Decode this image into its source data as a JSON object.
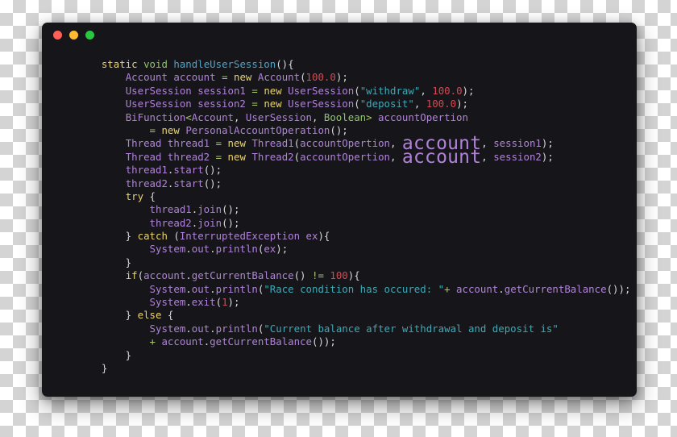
{
  "window": {
    "title": "",
    "traffic_lights": [
      {
        "name": "close",
        "color": "#ff5f57"
      },
      {
        "name": "minimize",
        "color": "#febc2e"
      },
      {
        "name": "zoom",
        "color": "#28c840"
      }
    ],
    "background_color": "#16161a"
  },
  "editor": {
    "language": "java",
    "emphasized_token": "account",
    "lines": [
      [
        {
          "t": "    ",
          "c": "pn"
        },
        {
          "t": "static",
          "c": "kw"
        },
        {
          "t": " ",
          "c": "pn"
        },
        {
          "t": "void",
          "c": "type2"
        },
        {
          "t": " ",
          "c": "pn"
        },
        {
          "t": "handleUserSession",
          "c": "fn"
        },
        {
          "t": "(){",
          "c": "pn"
        }
      ],
      [
        {
          "t": "        ",
          "c": "pn"
        },
        {
          "t": "Account",
          "c": "cls"
        },
        {
          "t": " ",
          "c": "pn"
        },
        {
          "t": "account",
          "c": "id"
        },
        {
          "t": " ",
          "c": "pn"
        },
        {
          "t": "=",
          "c": "op"
        },
        {
          "t": " ",
          "c": "pn"
        },
        {
          "t": "new",
          "c": "kw"
        },
        {
          "t": " ",
          "c": "pn"
        },
        {
          "t": "Account",
          "c": "cls"
        },
        {
          "t": "(",
          "c": "pn"
        },
        {
          "t": "100.0",
          "c": "num"
        },
        {
          "t": ");",
          "c": "pn"
        }
      ],
      [
        {
          "t": "        ",
          "c": "pn"
        },
        {
          "t": "UserSession",
          "c": "cls"
        },
        {
          "t": " ",
          "c": "pn"
        },
        {
          "t": "session1",
          "c": "id"
        },
        {
          "t": " ",
          "c": "pn"
        },
        {
          "t": "=",
          "c": "op"
        },
        {
          "t": " ",
          "c": "pn"
        },
        {
          "t": "new",
          "c": "kw"
        },
        {
          "t": " ",
          "c": "pn"
        },
        {
          "t": "UserSession",
          "c": "cls"
        },
        {
          "t": "(",
          "c": "pn"
        },
        {
          "t": "\"withdraw\"",
          "c": "str"
        },
        {
          "t": ", ",
          "c": "pn"
        },
        {
          "t": "100.0",
          "c": "num"
        },
        {
          "t": ");",
          "c": "pn"
        }
      ],
      [
        {
          "t": "        ",
          "c": "pn"
        },
        {
          "t": "UserSession",
          "c": "cls"
        },
        {
          "t": " ",
          "c": "pn"
        },
        {
          "t": "session2",
          "c": "id"
        },
        {
          "t": " ",
          "c": "pn"
        },
        {
          "t": "=",
          "c": "op"
        },
        {
          "t": " ",
          "c": "pn"
        },
        {
          "t": "new",
          "c": "kw"
        },
        {
          "t": " ",
          "c": "pn"
        },
        {
          "t": "UserSession",
          "c": "cls"
        },
        {
          "t": "(",
          "c": "pn"
        },
        {
          "t": "\"deposit\"",
          "c": "str"
        },
        {
          "t": ", ",
          "c": "pn"
        },
        {
          "t": "100.0",
          "c": "num"
        },
        {
          "t": ");",
          "c": "pn"
        }
      ],
      [
        {
          "t": "        ",
          "c": "pn"
        },
        {
          "t": "BiFunction",
          "c": "cls"
        },
        {
          "t": "<",
          "c": "op"
        },
        {
          "t": "Account",
          "c": "cls"
        },
        {
          "t": ", ",
          "c": "pn"
        },
        {
          "t": "UserSession",
          "c": "cls"
        },
        {
          "t": ", ",
          "c": "pn"
        },
        {
          "t": "Boolean",
          "c": "type2"
        },
        {
          "t": ">",
          "c": "op"
        },
        {
          "t": " ",
          "c": "pn"
        },
        {
          "t": "accountOpertion",
          "c": "id"
        }
      ],
      [
        {
          "t": "            ",
          "c": "pn"
        },
        {
          "t": "=",
          "c": "op"
        },
        {
          "t": " ",
          "c": "pn"
        },
        {
          "t": "new",
          "c": "kw"
        },
        {
          "t": " ",
          "c": "pn"
        },
        {
          "t": "PersonalAccountOperation",
          "c": "cls"
        },
        {
          "t": "();",
          "c": "pn"
        }
      ],
      [
        {
          "t": "        ",
          "c": "pn"
        },
        {
          "t": "Thread",
          "c": "cls"
        },
        {
          "t": " ",
          "c": "pn"
        },
        {
          "t": "thread1",
          "c": "id"
        },
        {
          "t": " ",
          "c": "pn"
        },
        {
          "t": "=",
          "c": "op"
        },
        {
          "t": " ",
          "c": "pn"
        },
        {
          "t": "new",
          "c": "kw"
        },
        {
          "t": " ",
          "c": "pn"
        },
        {
          "t": "Thread1",
          "c": "cls"
        },
        {
          "t": "(",
          "c": "pn"
        },
        {
          "t": "accountOpertion",
          "c": "id"
        },
        {
          "t": ", ",
          "c": "pn"
        },
        {
          "t": "account",
          "c": "id",
          "big": true
        },
        {
          "t": ", ",
          "c": "pn"
        },
        {
          "t": "session1",
          "c": "id"
        },
        {
          "t": ");",
          "c": "pn"
        }
      ],
      [
        {
          "t": "        ",
          "c": "pn"
        },
        {
          "t": "Thread",
          "c": "cls"
        },
        {
          "t": " ",
          "c": "pn"
        },
        {
          "t": "thread2",
          "c": "id"
        },
        {
          "t": " ",
          "c": "pn"
        },
        {
          "t": "=",
          "c": "op"
        },
        {
          "t": " ",
          "c": "pn"
        },
        {
          "t": "new",
          "c": "kw"
        },
        {
          "t": " ",
          "c": "pn"
        },
        {
          "t": "Thread2",
          "c": "cls"
        },
        {
          "t": "(",
          "c": "pn"
        },
        {
          "t": "accountOpertion",
          "c": "id"
        },
        {
          "t": ", ",
          "c": "pn"
        },
        {
          "t": "account",
          "c": "id",
          "big": true
        },
        {
          "t": ", ",
          "c": "pn"
        },
        {
          "t": "session2",
          "c": "id"
        },
        {
          "t": ");",
          "c": "pn"
        }
      ],
      [
        {
          "t": "        ",
          "c": "pn"
        },
        {
          "t": "thread1",
          "c": "id"
        },
        {
          "t": ".",
          "c": "pn"
        },
        {
          "t": "start",
          "c": "id"
        },
        {
          "t": "();",
          "c": "pn"
        }
      ],
      [
        {
          "t": "        ",
          "c": "pn"
        },
        {
          "t": "thread2",
          "c": "id"
        },
        {
          "t": ".",
          "c": "pn"
        },
        {
          "t": "start",
          "c": "id"
        },
        {
          "t": "();",
          "c": "pn"
        }
      ],
      [
        {
          "t": "        ",
          "c": "pn"
        },
        {
          "t": "try",
          "c": "kw"
        },
        {
          "t": " {",
          "c": "pn"
        }
      ],
      [
        {
          "t": "            ",
          "c": "pn"
        },
        {
          "t": "thread1",
          "c": "id"
        },
        {
          "t": ".",
          "c": "pn"
        },
        {
          "t": "join",
          "c": "id"
        },
        {
          "t": "();",
          "c": "pn"
        }
      ],
      [
        {
          "t": "            ",
          "c": "pn"
        },
        {
          "t": "thread2",
          "c": "id"
        },
        {
          "t": ".",
          "c": "pn"
        },
        {
          "t": "join",
          "c": "id"
        },
        {
          "t": "();",
          "c": "pn"
        }
      ],
      [
        {
          "t": "        } ",
          "c": "pn"
        },
        {
          "t": "catch",
          "c": "kw"
        },
        {
          "t": " (",
          "c": "pn"
        },
        {
          "t": "InterruptedException",
          "c": "cls"
        },
        {
          "t": " ",
          "c": "pn"
        },
        {
          "t": "ex",
          "c": "id"
        },
        {
          "t": "){",
          "c": "pn"
        }
      ],
      [
        {
          "t": "            ",
          "c": "pn"
        },
        {
          "t": "System",
          "c": "id"
        },
        {
          "t": ".",
          "c": "pn"
        },
        {
          "t": "out",
          "c": "id"
        },
        {
          "t": ".",
          "c": "pn"
        },
        {
          "t": "println",
          "c": "id"
        },
        {
          "t": "(",
          "c": "pn"
        },
        {
          "t": "ex",
          "c": "id"
        },
        {
          "t": ");",
          "c": "pn"
        }
      ],
      [
        {
          "t": "        }",
          "c": "pn"
        }
      ],
      [
        {
          "t": "        ",
          "c": "pn"
        },
        {
          "t": "if",
          "c": "kw"
        },
        {
          "t": "(",
          "c": "pn"
        },
        {
          "t": "account",
          "c": "id"
        },
        {
          "t": ".",
          "c": "pn"
        },
        {
          "t": "getCurrentBalance",
          "c": "id"
        },
        {
          "t": "() ",
          "c": "pn"
        },
        {
          "t": "!=",
          "c": "op"
        },
        {
          "t": " ",
          "c": "pn"
        },
        {
          "t": "100",
          "c": "num"
        },
        {
          "t": "){",
          "c": "pn"
        }
      ],
      [
        {
          "t": "            ",
          "c": "pn"
        },
        {
          "t": "System",
          "c": "id"
        },
        {
          "t": ".",
          "c": "pn"
        },
        {
          "t": "out",
          "c": "id"
        },
        {
          "t": ".",
          "c": "pn"
        },
        {
          "t": "println",
          "c": "id"
        },
        {
          "t": "(",
          "c": "pn"
        },
        {
          "t": "\"Race condition has occured: \"",
          "c": "str"
        },
        {
          "t": "+",
          "c": "op"
        },
        {
          "t": " ",
          "c": "pn"
        },
        {
          "t": "account",
          "c": "id"
        },
        {
          "t": ".",
          "c": "pn"
        },
        {
          "t": "getCurrentBalance",
          "c": "id"
        },
        {
          "t": "());",
          "c": "pn"
        }
      ],
      [
        {
          "t": "            ",
          "c": "pn"
        },
        {
          "t": "System",
          "c": "id"
        },
        {
          "t": ".",
          "c": "pn"
        },
        {
          "t": "exit",
          "c": "id"
        },
        {
          "t": "(",
          "c": "pn"
        },
        {
          "t": "1",
          "c": "num"
        },
        {
          "t": ");",
          "c": "pn"
        }
      ],
      [
        {
          "t": "        } ",
          "c": "pn"
        },
        {
          "t": "else",
          "c": "kw"
        },
        {
          "t": " {",
          "c": "pn"
        }
      ],
      [
        {
          "t": "            ",
          "c": "pn"
        },
        {
          "t": "System",
          "c": "id"
        },
        {
          "t": ".",
          "c": "pn"
        },
        {
          "t": "out",
          "c": "id"
        },
        {
          "t": ".",
          "c": "pn"
        },
        {
          "t": "println",
          "c": "id"
        },
        {
          "t": "(",
          "c": "pn"
        },
        {
          "t": "\"Current balance after withdrawal and deposit is\"",
          "c": "str"
        }
      ],
      [
        {
          "t": "            ",
          "c": "pn"
        },
        {
          "t": "+",
          "c": "op"
        },
        {
          "t": " ",
          "c": "pn"
        },
        {
          "t": "account",
          "c": "id"
        },
        {
          "t": ".",
          "c": "pn"
        },
        {
          "t": "getCurrentBalance",
          "c": "id"
        },
        {
          "t": "());",
          "c": "pn"
        }
      ],
      [
        {
          "t": "        }",
          "c": "pn"
        }
      ],
      [
        {
          "t": "    }",
          "c": "pn"
        }
      ]
    ]
  }
}
